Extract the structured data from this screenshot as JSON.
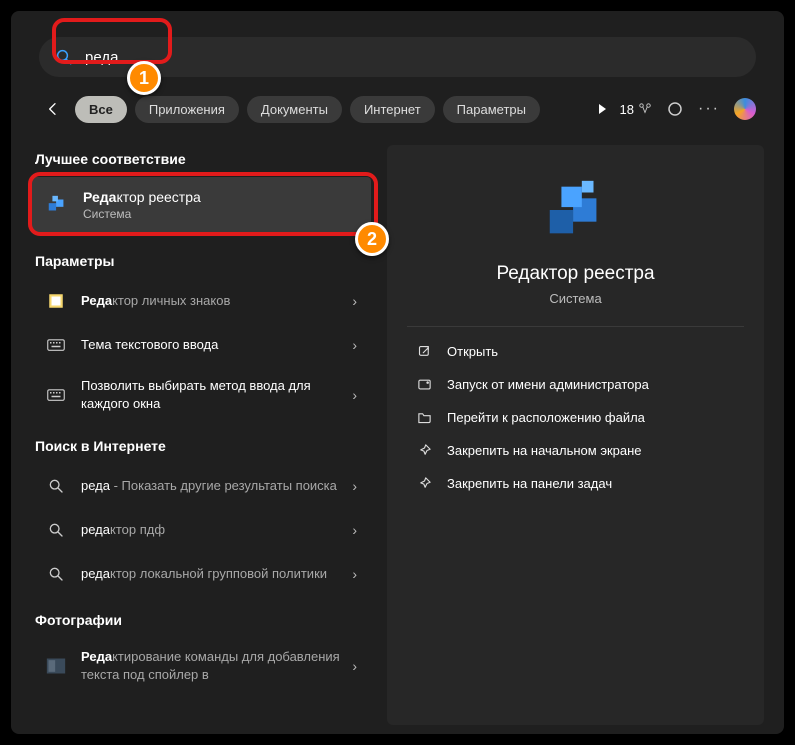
{
  "search": {
    "value": "реда"
  },
  "filters": {
    "items": [
      {
        "label": "Все",
        "active": true
      },
      {
        "label": "Приложения"
      },
      {
        "label": "Документы"
      },
      {
        "label": "Интернет"
      },
      {
        "label": "Параметры"
      }
    ],
    "points": "18"
  },
  "left": {
    "best_header": "Лучшее соответствие",
    "best": {
      "title_pre": "Реда",
      "title_rest": "ктор реестра",
      "sub": "Система"
    },
    "params_header": "Параметры",
    "params": [
      {
        "pre": "Реда",
        "rest": "ктор личных знаков"
      },
      {
        "pre": "",
        "rest": "Тема текстового ввода"
      },
      {
        "pre": "",
        "rest": "Позволить выбирать метод ввода для каждого окна"
      }
    ],
    "web_header": "Поиск в Интернете",
    "web": [
      {
        "pre": "реда",
        "rest": " - Показать другие результаты поиска"
      },
      {
        "pre": "реда",
        "rest": "ктор пдф"
      },
      {
        "pre": "реда",
        "rest": "ктор локальной групповой политики"
      }
    ],
    "photos_header": "Фотографии",
    "photos": [
      {
        "pre": "Реда",
        "rest": "ктирование команды для добавления текста под спойлер в"
      }
    ]
  },
  "right": {
    "title": "Редактор реестра",
    "sub": "Система",
    "actions": [
      "Открыть",
      "Запуск от имени администратора",
      "Перейти к расположению файла",
      "Закрепить на начальном экране",
      "Закрепить на панели задач"
    ]
  },
  "annotations": {
    "b1": "1",
    "b2": "2"
  }
}
